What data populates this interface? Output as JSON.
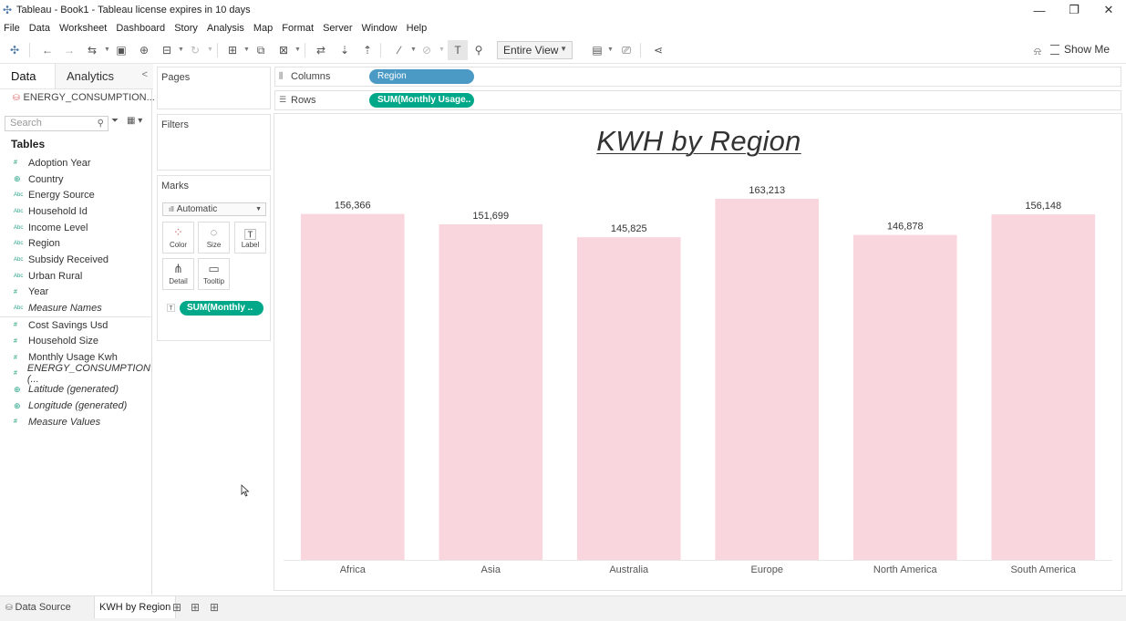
{
  "window": {
    "title": "Tableau - Book1 - Tableau license expires in 10 days"
  },
  "menu": [
    "File",
    "Data",
    "Worksheet",
    "Dashboard",
    "Story",
    "Analysis",
    "Map",
    "Format",
    "Server",
    "Window",
    "Help"
  ],
  "toolbar": {
    "fit_value": "Entire View",
    "show_me_label": "Show Me"
  },
  "data_pane": {
    "tabs": {
      "data": "Data",
      "analytics": "Analytics"
    },
    "datasource": "ENERGY_CONSUMPTION...",
    "search_placeholder": "Search",
    "tables_header": "Tables",
    "dimensions": [
      {
        "name": "Adoption Year",
        "type": "number"
      },
      {
        "name": "Country",
        "type": "geo"
      },
      {
        "name": "Energy Source",
        "type": "string"
      },
      {
        "name": "Household Id",
        "type": "string"
      },
      {
        "name": "Income Level",
        "type": "string"
      },
      {
        "name": "Region",
        "type": "string"
      },
      {
        "name": "Subsidy Received",
        "type": "string"
      },
      {
        "name": "Urban Rural",
        "type": "string"
      },
      {
        "name": "Year",
        "type": "number"
      },
      {
        "name": "Measure Names",
        "type": "string",
        "italic": true
      }
    ],
    "measures": [
      {
        "name": "Cost Savings Usd",
        "type": "number"
      },
      {
        "name": "Household Size",
        "type": "number"
      },
      {
        "name": "Monthly Usage Kwh",
        "type": "number"
      },
      {
        "name": "ENERGY_CONSUMPTION (...",
        "type": "number",
        "italic": true
      },
      {
        "name": "Latitude (generated)",
        "type": "geo",
        "italic": true
      },
      {
        "name": "Longitude (generated)",
        "type": "geo",
        "italic": true
      },
      {
        "name": "Measure Values",
        "type": "number",
        "italic": true
      }
    ]
  },
  "cards": {
    "pages": "Pages",
    "filters": "Filters",
    "marks": "Marks",
    "mark_type": "Automatic",
    "mark_buttons": [
      "Color",
      "Size",
      "Label",
      "Detail",
      "Tooltip"
    ],
    "marks_pill": "SUM(Monthly .."
  },
  "shelves": {
    "columns_label": "Columns",
    "columns_pill": "Region",
    "rows_label": "Rows",
    "rows_pill": "SUM(Monthly Usage.."
  },
  "chart_data": {
    "type": "bar",
    "title": "KWH by Region",
    "categories": [
      "Africa",
      "Asia",
      "Australia",
      "Europe",
      "North America",
      "South America"
    ],
    "values": [
      156366,
      151699,
      145825,
      163213,
      146878,
      156148
    ],
    "value_labels": [
      "156,366",
      "151,699",
      "145,825",
      "163,213",
      "146,878",
      "156,148"
    ],
    "bar_color": "#f9d5de",
    "ylim": [
      0,
      163213
    ],
    "grid": false
  },
  "tabs": {
    "data_source": "Data Source",
    "sheet": "KWH by Region"
  },
  "colors": {
    "pill_dimension": "#4b9ac5",
    "pill_measure": "#00a88a"
  }
}
